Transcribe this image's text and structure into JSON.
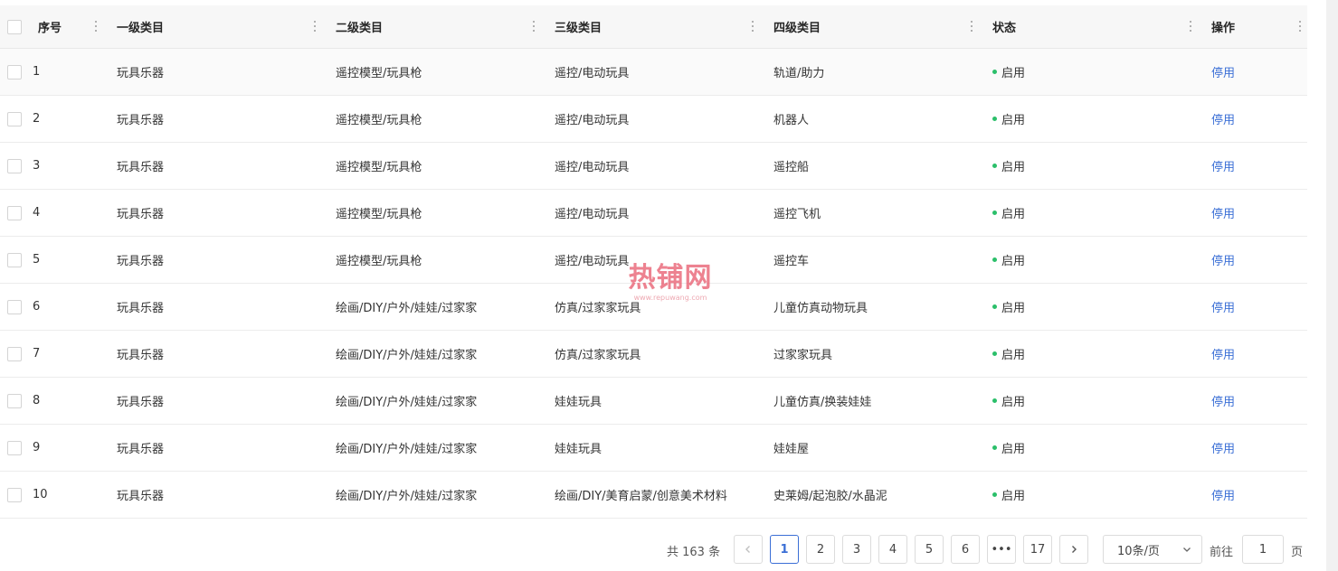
{
  "table": {
    "headers": {
      "index": "序号",
      "level1": "一级类目",
      "level2": "二级类目",
      "level3": "三级类目",
      "level4": "四级类目",
      "status": "状态",
      "operation": "操作"
    },
    "rows": [
      {
        "index": "1",
        "level1": "玩具乐器",
        "level2": "遥控模型/玩具枪",
        "level3": "遥控/电动玩具",
        "level4": "轨道/助力",
        "status": "启用",
        "action": "停用"
      },
      {
        "index": "2",
        "level1": "玩具乐器",
        "level2": "遥控模型/玩具枪",
        "level3": "遥控/电动玩具",
        "level4": "机器人",
        "status": "启用",
        "action": "停用"
      },
      {
        "index": "3",
        "level1": "玩具乐器",
        "level2": "遥控模型/玩具枪",
        "level3": "遥控/电动玩具",
        "level4": "遥控船",
        "status": "启用",
        "action": "停用"
      },
      {
        "index": "4",
        "level1": "玩具乐器",
        "level2": "遥控模型/玩具枪",
        "level3": "遥控/电动玩具",
        "level4": "遥控飞机",
        "status": "启用",
        "action": "停用"
      },
      {
        "index": "5",
        "level1": "玩具乐器",
        "level2": "遥控模型/玩具枪",
        "level3": "遥控/电动玩具",
        "level4": "遥控车",
        "status": "启用",
        "action": "停用"
      },
      {
        "index": "6",
        "level1": "玩具乐器",
        "level2": "绘画/DIY/户外/娃娃/过家家",
        "level3": "仿真/过家家玩具",
        "level4": "儿童仿真动物玩具",
        "status": "启用",
        "action": "停用"
      },
      {
        "index": "7",
        "level1": "玩具乐器",
        "level2": "绘画/DIY/户外/娃娃/过家家",
        "level3": "仿真/过家家玩具",
        "level4": "过家家玩具",
        "status": "启用",
        "action": "停用"
      },
      {
        "index": "8",
        "level1": "玩具乐器",
        "level2": "绘画/DIY/户外/娃娃/过家家",
        "level3": "娃娃玩具",
        "level4": "儿童仿真/换装娃娃",
        "status": "启用",
        "action": "停用"
      },
      {
        "index": "9",
        "level1": "玩具乐器",
        "level2": "绘画/DIY/户外/娃娃/过家家",
        "level3": "娃娃玩具",
        "level4": "娃娃屋",
        "status": "启用",
        "action": "停用"
      },
      {
        "index": "10",
        "level1": "玩具乐器",
        "level2": "绘画/DIY/户外/娃娃/过家家",
        "level3": "绘画/DIY/美育启蒙/创意美术材料",
        "level4": "史莱姆/起泡胶/水晶泥",
        "status": "启用",
        "action": "停用"
      }
    ]
  },
  "pagination": {
    "total": "共 163 条",
    "pages": [
      "1",
      "2",
      "3",
      "4",
      "5",
      "6",
      "•••",
      "17"
    ],
    "active_page": "1",
    "page_size": "10条/页",
    "goto_label": "前往",
    "goto_value": "1",
    "page_suffix": "页"
  },
  "watermark": {
    "main": "热铺网",
    "sub": "www.repuwang.com"
  },
  "colors": {
    "link": "#3b6fd6",
    "status_enabled": "#2bbf6a",
    "header_bg": "#f7f7f7"
  }
}
